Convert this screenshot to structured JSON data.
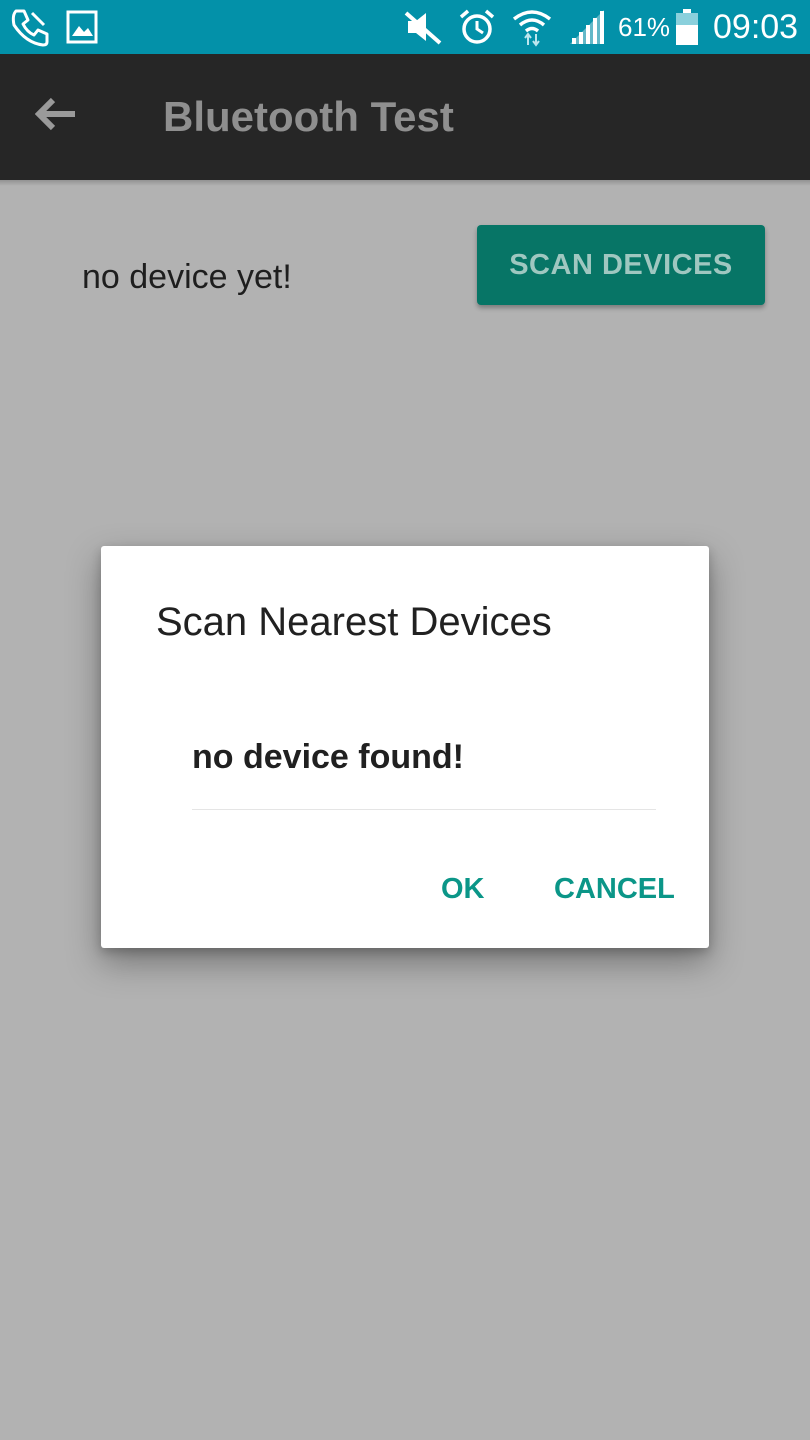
{
  "status_bar": {
    "battery_text": "61%",
    "time": "09:03",
    "icons": [
      "phone-call-icon",
      "image-icon",
      "mute-icon",
      "alarm-icon",
      "wifi-icon",
      "signal-icon",
      "battery-icon"
    ],
    "color": "#0391a9"
  },
  "app_bar": {
    "title": "Bluetooth Test",
    "back_icon": "arrow-left-icon",
    "color": "#262626"
  },
  "main": {
    "status_text": "no device yet!",
    "scan_button_label": "SCAN DEVICES",
    "button_color": "#077566"
  },
  "dialog": {
    "title": "Scan Nearest Devices",
    "message": "no device found!",
    "ok_label": "OK",
    "cancel_label": "CANCEL",
    "accent": "#0b9688"
  }
}
